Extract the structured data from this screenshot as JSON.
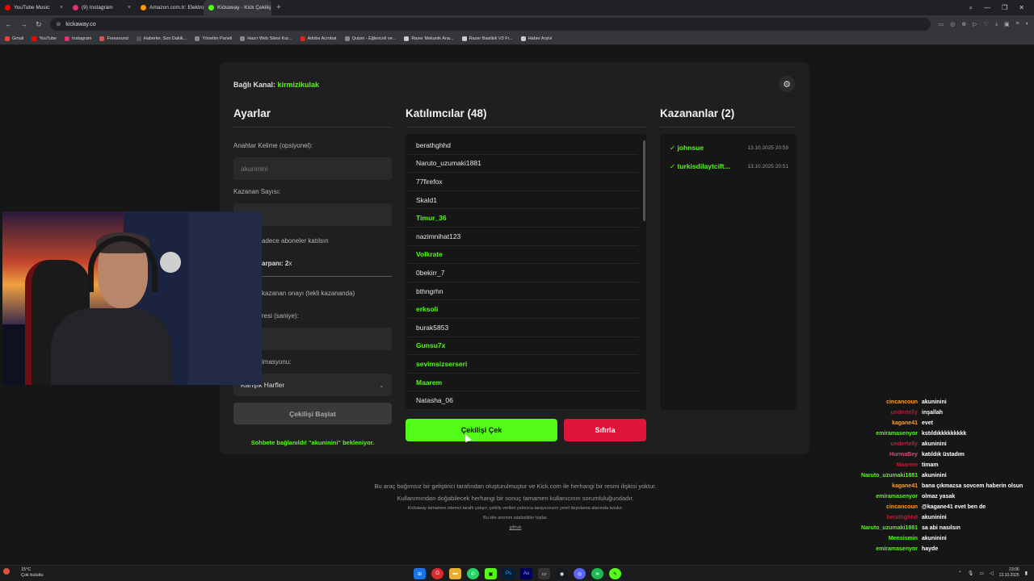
{
  "browser": {
    "tabs": [
      {
        "label": "YouTube Music",
        "color": "#ff0000"
      },
      {
        "label": "(9) Instagram",
        "color": "#e1306c"
      },
      {
        "label": "Amazon.com.tr: Elektroni",
        "color": "#ff9900"
      },
      {
        "label": "Kickaway - Kick Çekiliş Ar",
        "color": "#53fc18"
      }
    ],
    "url": "kickaway.co",
    "bookmarks": [
      {
        "label": "Gmail",
        "color": "#ea4335"
      },
      {
        "label": "YouTube",
        "color": "#ff0000"
      },
      {
        "label": "Instagram",
        "color": "#e1306c"
      },
      {
        "label": "Freesound",
        "color": "#d9534f"
      },
      {
        "label": "Haberler, Son Dakik...",
        "color": "#555555"
      },
      {
        "label": "Yönetim Paneli",
        "color": "#888888"
      },
      {
        "label": "Hazır Web Sitesi Kur...",
        "color": "#888888"
      },
      {
        "label": "Adobe Acrobat",
        "color": "#e2231a"
      },
      {
        "label": "Quizei - Eğlenceli ve...",
        "color": "#888888"
      },
      {
        "label": "Razer Mekanik Ana...",
        "color": "#cccccc"
      },
      {
        "label": "Razer Basilisk V3 Fr...",
        "color": "#cccccc"
      },
      {
        "label": "Haber Arşivi",
        "color": "#cccccc"
      }
    ]
  },
  "page": {
    "channel_prefix": "Bağlı Kanal:",
    "channel_name": "kirmizikulak",
    "settings_section": {
      "title": "Ayarlar",
      "keyword_label": "Anahtar Kelime (opsiyonel):",
      "keyword_value": "akuninini",
      "winner_count_label": "Kazanan Sayısı:",
      "subs_only_label": "adece aboneler katılsın",
      "multiplier_label": "arpanı: 2",
      "multiplier_suffix": "x",
      "approval_label": "kazanan onayı (tekli kazananda)",
      "duration_label": "resi (saniye):",
      "animation_label": "imasyonu:",
      "animation_value": "Karışık Harfler",
      "start_button": "Çekilişi Başlat",
      "status_text": "Sohbete bağlanıldı! \"akuninini\" bekleniyor."
    },
    "participants": {
      "title": "Katılımcılar (48)",
      "items": [
        {
          "name": "berathghhd",
          "sub": false
        },
        {
          "name": "Naruto_uzumaki1881",
          "sub": false
        },
        {
          "name": "77firefox",
          "sub": false
        },
        {
          "name": "Skald1",
          "sub": false
        },
        {
          "name": "Timur_36",
          "sub": true
        },
        {
          "name": "nazimnihat123",
          "sub": false
        },
        {
          "name": "Volkrate",
          "sub": true
        },
        {
          "name": "0bekirr_7",
          "sub": false
        },
        {
          "name": "bthngrhn",
          "sub": false
        },
        {
          "name": "erksoli",
          "sub": true
        },
        {
          "name": "burak5853",
          "sub": false
        },
        {
          "name": "Gunsu7x",
          "sub": true
        },
        {
          "name": "sevimsizserseri",
          "sub": true
        },
        {
          "name": "Maarem",
          "sub": true
        },
        {
          "name": "Natasha_06",
          "sub": false
        }
      ],
      "draw_button": "Çekilişi Çek",
      "reset_button": "Sıfırla"
    },
    "winners": {
      "title": "Kazananlar (2)",
      "items": [
        {
          "name": "johnsue",
          "time": "13.10.2025 20:59"
        },
        {
          "name": "turkisdilaytcift...",
          "time": "13.10.2025 20:51"
        }
      ]
    },
    "footer": {
      "line1": "Bu araç bağımsız bir geliştirici tarafından oluşturulmuştur ve Kick.com ile herhangi bir resmi ilişkisi yoktur.",
      "line2": "Kullanımından doğabilecek herhangi bir sonuç tamamen kullanıcının sorumluluğundadır.",
      "line3": "Kickaway tamamen istemci taraflı çalışır; çekiliş verileri yalnızca tarayıcınızın yerel depolama alanında tutulur.",
      "line4": "Bu site anonim istatistikler toplar.",
      "link": "github"
    }
  },
  "chat": [
    {
      "user": "cincancoun",
      "color": "#ff9d2e",
      "msg": "akuninini"
    },
    {
      "user": "undertelly",
      "color": "#b0203a",
      "msg": "inşallah"
    },
    {
      "user": "kagane41",
      "color": "#ff9d2e",
      "msg": "evet"
    },
    {
      "user": "emiramasenyor",
      "color": "#53fc18",
      "msg": "kstıldıkkkkkkkkk"
    },
    {
      "user": "undertelly",
      "color": "#b0203a",
      "msg": "akuninini"
    },
    {
      "user": "HurmaBey",
      "color": "#d94a7a",
      "msg": "katıldık üstadım"
    },
    {
      "user": "Maarem",
      "color": "#b0203a",
      "msg": "timam"
    },
    {
      "user": "Naruto_uzumaki1881",
      "color": "#53fc18",
      "msg": "akuninini"
    },
    {
      "user": "kagane41",
      "color": "#ff9d2e",
      "msg": "bana çıkmazsa sovcem haberin olsun"
    },
    {
      "user": "emiramasenyor",
      "color": "#53fc18",
      "msg": "olmaz yasak"
    },
    {
      "user": "cincancoun",
      "color": "#ff9d2e",
      "msg": "@kagane41 evet ben de"
    },
    {
      "user": "berathghhd",
      "color": "#b0203a",
      "msg": "akuninini"
    },
    {
      "user": "Naruto_uzumaki1881",
      "color": "#53fc18",
      "msg": "sa abi nasılsın"
    },
    {
      "user": "Mensismin",
      "color": "#53fc18",
      "msg": "akuninini"
    },
    {
      "user": "emiramasenyor",
      "color": "#53fc18",
      "msg": "hayde"
    }
  ],
  "taskbar": {
    "temperature": "15°C",
    "weather": "Çok bulutlu",
    "time": "23:06",
    "date": "13.10.2025"
  }
}
